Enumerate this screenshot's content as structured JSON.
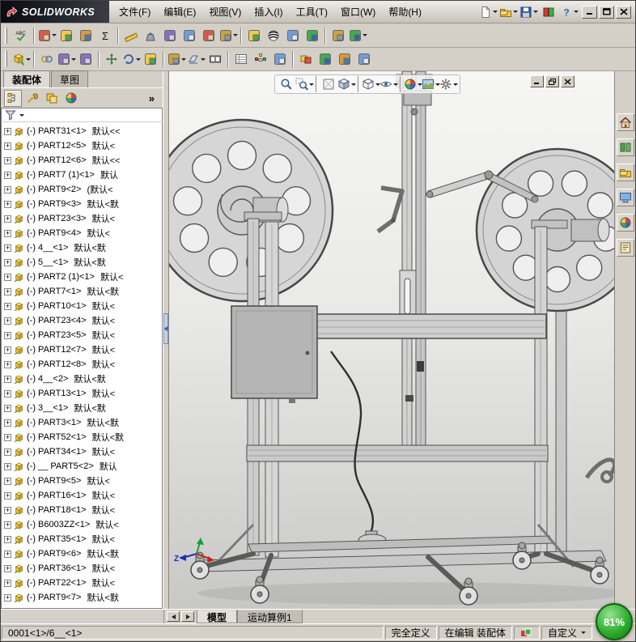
{
  "titlebar": {
    "brand": "SOLIDWORKS",
    "menus": [
      "文件(F)",
      "编辑(E)",
      "视图(V)",
      "插入(I)",
      "工具(T)",
      "窗口(W)",
      "帮助(H)"
    ],
    "quick_icons": [
      {
        "icon": "new-document",
        "caret": true
      },
      {
        "icon": "open-document",
        "caret": true
      },
      {
        "icon": "save",
        "caret": true
      },
      {
        "icon": "solidworks-resources"
      },
      {
        "icon": "help",
        "caret": true
      }
    ]
  },
  "toolbars": {
    "tools": {
      "items": [
        {
          "icon": "spell-check"
        },
        {
          "sep": true
        },
        {
          "icon": "select-filter",
          "caret": true
        },
        {
          "icon": "comment"
        },
        {
          "icon": "design-binder"
        },
        {
          "icon": "equations"
        },
        {
          "sep": true
        },
        {
          "icon": "measure"
        },
        {
          "icon": "mass-properties"
        },
        {
          "icon": "section-properties"
        },
        {
          "icon": "check"
        },
        {
          "icon": "statistics"
        },
        {
          "icon": "import-diagnostics",
          "caret": true
        },
        {
          "sep": true
        },
        {
          "icon": "deviation-analysis"
        },
        {
          "icon": "zebra-stripes"
        },
        {
          "icon": "draft-analysis"
        },
        {
          "icon": "undercut-analysis"
        },
        {
          "sep": true
        },
        {
          "icon": "options"
        },
        {
          "icon": "macro",
          "caret": true
        }
      ]
    },
    "assembly": {
      "items": [
        {
          "icon": "insert-component",
          "caret": true
        },
        {
          "sep": true
        },
        {
          "icon": "mate"
        },
        {
          "icon": "linear-component-pattern",
          "caret": true
        },
        {
          "icon": "smart-fasteners"
        },
        {
          "sep": true
        },
        {
          "icon": "move-component"
        },
        {
          "icon": "rotate-component",
          "caret": true
        },
        {
          "icon": "show-hidden-components"
        },
        {
          "sep": true
        },
        {
          "icon": "assembly-features",
          "caret": true
        },
        {
          "icon": "reference-geometry",
          "caret": true
        },
        {
          "icon": "new-motion-study"
        },
        {
          "sep": true
        },
        {
          "icon": "bill-of-materials"
        },
        {
          "icon": "exploded-view"
        },
        {
          "icon": "explode-line-sketch"
        },
        {
          "sep": true
        },
        {
          "icon": "interference-detection"
        },
        {
          "icon": "clearance-verification"
        },
        {
          "icon": "assemblyxpert"
        },
        {
          "icon": "instant3d"
        }
      ]
    }
  },
  "left_panel": {
    "tabs": [
      {
        "label": "装配体",
        "name": "assembly",
        "active": true
      },
      {
        "label": "草图",
        "name": "sketch",
        "active": false
      }
    ],
    "fm_tabs": [
      {
        "icon": "featuremanager-tree",
        "active": true
      },
      {
        "icon": "propertymanager"
      },
      {
        "icon": "configurationmanager"
      },
      {
        "icon": "appearances"
      }
    ],
    "expand_glyph": "»",
    "tree": [
      {
        "label": "(-) PART31<1>",
        "config": "默认<<"
      },
      {
        "label": "(-) PART12<5>",
        "config": "默认<"
      },
      {
        "label": "(-) PART12<6>",
        "config": "默认<<"
      },
      {
        "label": "(-) PART7 (1)<1>",
        "config": "默认"
      },
      {
        "label": "(-) PART9<2>",
        "config": "(默认<"
      },
      {
        "label": "(-) PART9<3>",
        "config": "默认<默"
      },
      {
        "label": "(-) PART23<3>",
        "config": "默认<"
      },
      {
        "label": "(-) PART9<4>",
        "config": "默认<"
      },
      {
        "label": "(-) 4__<1>",
        "config": "默认<默"
      },
      {
        "label": "(-) 5__<1>",
        "config": "默认<默"
      },
      {
        "label": "(-) PART2 (1)<1>",
        "config": "默认<"
      },
      {
        "label": "(-) PART7<1>",
        "config": "默认<默"
      },
      {
        "label": "(-) PART10<1>",
        "config": "默认<"
      },
      {
        "label": "(-) PART23<4>",
        "config": "默认<"
      },
      {
        "label": "(-) PART23<5>",
        "config": "默认<"
      },
      {
        "label": "(-) PART12<7>",
        "config": "默认<"
      },
      {
        "label": "(-) PART12<8>",
        "config": "默认<"
      },
      {
        "label": "(-) 4__<2>",
        "config": "默认<默"
      },
      {
        "label": "(-) PART13<1>",
        "config": "默认<"
      },
      {
        "label": "(-) 3__<1>",
        "config": "默认<默"
      },
      {
        "label": "(-) PART3<1>",
        "config": "默认<默"
      },
      {
        "label": "(-) PART52<1>",
        "config": "默认<默"
      },
      {
        "label": "(-) PART34<1>",
        "config": "默认<"
      },
      {
        "label": "(-) __ PART5<2>",
        "config": "默认"
      },
      {
        "label": "(-) PART9<5>",
        "config": "默认<"
      },
      {
        "label": "(-) PART16<1>",
        "config": "默认<"
      },
      {
        "label": "(-) PART18<1>",
        "config": "默认<"
      },
      {
        "label": "(-) B6003ZZ<1>",
        "config": "默认<"
      },
      {
        "label": "(-) PART35<1>",
        "config": "默认<"
      },
      {
        "label": "(-) PART9<6>",
        "config": "默认<默"
      },
      {
        "label": "(-) PART36<1>",
        "config": "默认<"
      },
      {
        "label": "(-) PART22<1>",
        "config": "默认<"
      },
      {
        "label": "(-) PART9<7>",
        "config": "默认<默"
      }
    ]
  },
  "viewport": {
    "headsup": [
      {
        "icon": "zoom-fit"
      },
      {
        "icon": "zoom-area",
        "caret": true
      },
      {
        "sep": true
      },
      {
        "icon": "view-selector"
      },
      {
        "icon": "view-orientation",
        "caret": true
      },
      {
        "sep": true
      },
      {
        "icon": "display-style",
        "caret": true
      },
      {
        "icon": "hide-show-items",
        "caret": true
      },
      {
        "sep": true
      },
      {
        "icon": "edit-appearance",
        "caret": true
      },
      {
        "icon": "apply-scene",
        "caret": true
      },
      {
        "icon": "view-settings",
        "caret": true
      }
    ],
    "triad_z": "Z"
  },
  "right_strip": [
    {
      "icon": "task-pane-home"
    },
    {
      "icon": "design-library"
    },
    {
      "icon": "file-explorer"
    },
    {
      "icon": "view-palette"
    },
    {
      "icon": "appearances-scenes"
    },
    {
      "icon": "custom-properties"
    }
  ],
  "bottom": {
    "tabs": [
      {
        "label": "模型",
        "name": "model",
        "active": true
      },
      {
        "label": "运动算例1",
        "name": "motion-study-1",
        "active": false
      }
    ]
  },
  "status": {
    "position": "0001<1>/6__<1>",
    "defined": "完全定义",
    "editing": "在编辑 装配体",
    "custom": "自定义"
  },
  "overlay": {
    "text": "81%"
  },
  "colors": {
    "chrome": "#d4d0c8",
    "viewport_top": "#f6f6f4",
    "viewport_bottom": "#cbcbc9",
    "overlay_green": "#2fae2f"
  }
}
